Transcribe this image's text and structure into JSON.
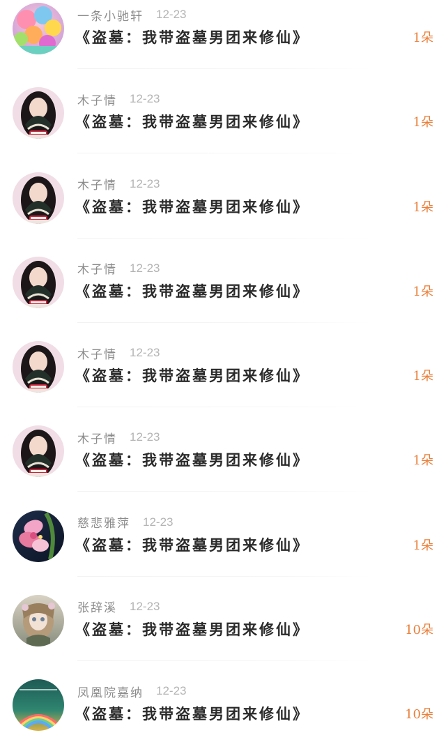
{
  "list": {
    "items": [
      {
        "username": "一条小驰轩",
        "date": "12-23",
        "book_title": "《盗墓：我带盗墓男团来修仙》",
        "flowers": "1朵",
        "avatar": "colorful-balloons"
      },
      {
        "username": "木子情",
        "date": "12-23",
        "book_title": "《盗墓：我带盗墓男团来修仙》",
        "flowers": "1朵",
        "avatar": "girl-with-fan"
      },
      {
        "username": "木子情",
        "date": "12-23",
        "book_title": "《盗墓：我带盗墓男团来修仙》",
        "flowers": "1朵",
        "avatar": "girl-with-fan"
      },
      {
        "username": "木子情",
        "date": "12-23",
        "book_title": "《盗墓：我带盗墓男团来修仙》",
        "flowers": "1朵",
        "avatar": "girl-with-fan"
      },
      {
        "username": "木子情",
        "date": "12-23",
        "book_title": "《盗墓：我带盗墓男团来修仙》",
        "flowers": "1朵",
        "avatar": "girl-with-fan"
      },
      {
        "username": "木子情",
        "date": "12-23",
        "book_title": "《盗墓：我带盗墓男团来修仙》",
        "flowers": "1朵",
        "avatar": "girl-with-fan"
      },
      {
        "username": "慈悲雅萍",
        "date": "12-23",
        "book_title": "《盗墓：我带盗墓男团来修仙》",
        "flowers": "1朵",
        "avatar": "pink-orchid"
      },
      {
        "username": "张辞溪",
        "date": "12-23",
        "book_title": "《盗墓：我带盗墓男团来修仙》",
        "flowers": "10朵",
        "avatar": "anime-doll-girl"
      },
      {
        "username": "凤凰院嘉纳",
        "date": "12-23",
        "book_title": "《盗墓：我带盗墓男团来修仙》",
        "flowers": "10朵",
        "avatar": "rainbow-landscape"
      }
    ]
  },
  "colors": {
    "username": "#8c8c8c",
    "date": "#b4b4b4",
    "title": "#2a2a2a",
    "flowers": "#ea7f3a"
  }
}
